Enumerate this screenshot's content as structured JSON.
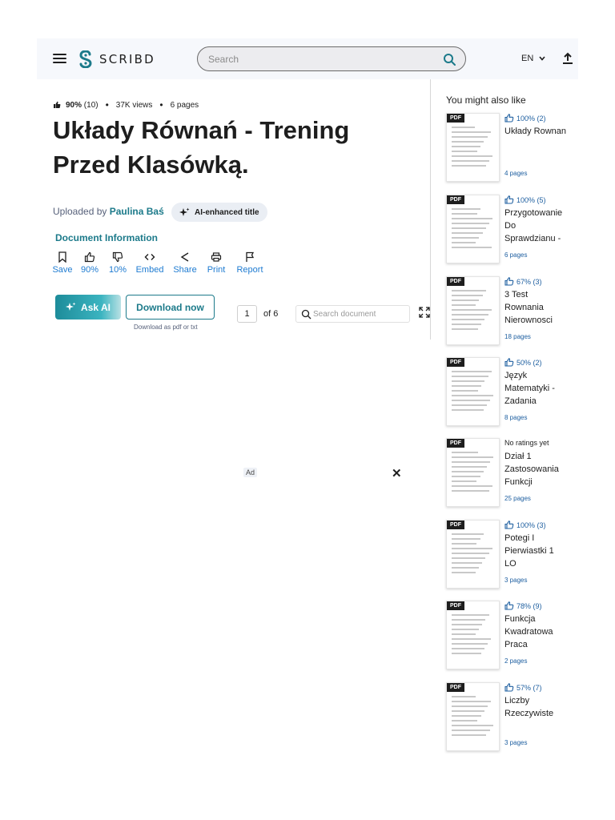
{
  "header": {
    "logo_text": "SCRIBD",
    "search_placeholder": "Search",
    "language": "EN"
  },
  "document": {
    "rating": "90%",
    "rating_count": "(10)",
    "views": "37K views",
    "pages": "6 pages",
    "title": "Układy Równań - Trening Przed Klasówką.",
    "uploaded_by_label": "Uploaded by",
    "uploader": "Paulina Baś",
    "ai_badge": "AI-enhanced title",
    "info_link": "Document Information"
  },
  "actions": [
    {
      "label": "Save",
      "icon": "bookmark-icon"
    },
    {
      "label": "90%",
      "icon": "thumbs-up-icon"
    },
    {
      "label": "10%",
      "icon": "thumbs-down-icon"
    },
    {
      "label": "Embed",
      "icon": "embed-icon"
    },
    {
      "label": "Share",
      "icon": "share-icon"
    },
    {
      "label": "Print",
      "icon": "print-icon"
    },
    {
      "label": "Report",
      "icon": "flag-icon"
    }
  ],
  "toolbar": {
    "ask_ai": "Ask AI",
    "download": "Download now",
    "download_note": "Download as pdf or txt",
    "current_page": "1",
    "page_of": "of 6",
    "doc_search_placeholder": "Search document"
  },
  "ad": {
    "label": "Ad",
    "close": "✕"
  },
  "sidebar": {
    "title": "You might also like",
    "items": [
      {
        "tag": "PDF",
        "rating": "100% (2)",
        "title": "Układy Rownan",
        "pages": "4 pages"
      },
      {
        "tag": "PDF",
        "rating": "100% (5)",
        "title": "Przygotowanie Do Sprawdzianu -",
        "pages": "6 pages"
      },
      {
        "tag": "PDF",
        "rating": "67% (3)",
        "title": "3 Test Rownania Nierownosci",
        "pages": "18 pages"
      },
      {
        "tag": "PDF",
        "rating": "50% (2)",
        "title": "Język Matematyki - Zadania",
        "pages": "8 pages"
      },
      {
        "tag": "PDF",
        "rating": "No ratings yet",
        "title": "Dział 1 Zastosowania Funkcji",
        "pages": "25 pages"
      },
      {
        "tag": "PDF",
        "rating": "100% (3)",
        "title": "Potegi I Pierwiastki 1 LO",
        "pages": "3 pages"
      },
      {
        "tag": "PDF",
        "rating": "78% (9)",
        "title": "Funkcja Kwadratowa Praca",
        "pages": "2 pages"
      },
      {
        "tag": "PDF",
        "rating": "57% (7)",
        "title": "Liczby Rzeczywiste",
        "pages": "3 pages"
      }
    ]
  },
  "colors": {
    "accent": "#1c7a8a",
    "link_blue": "#1e7bd1",
    "header_bg": "#f6f8fc"
  }
}
